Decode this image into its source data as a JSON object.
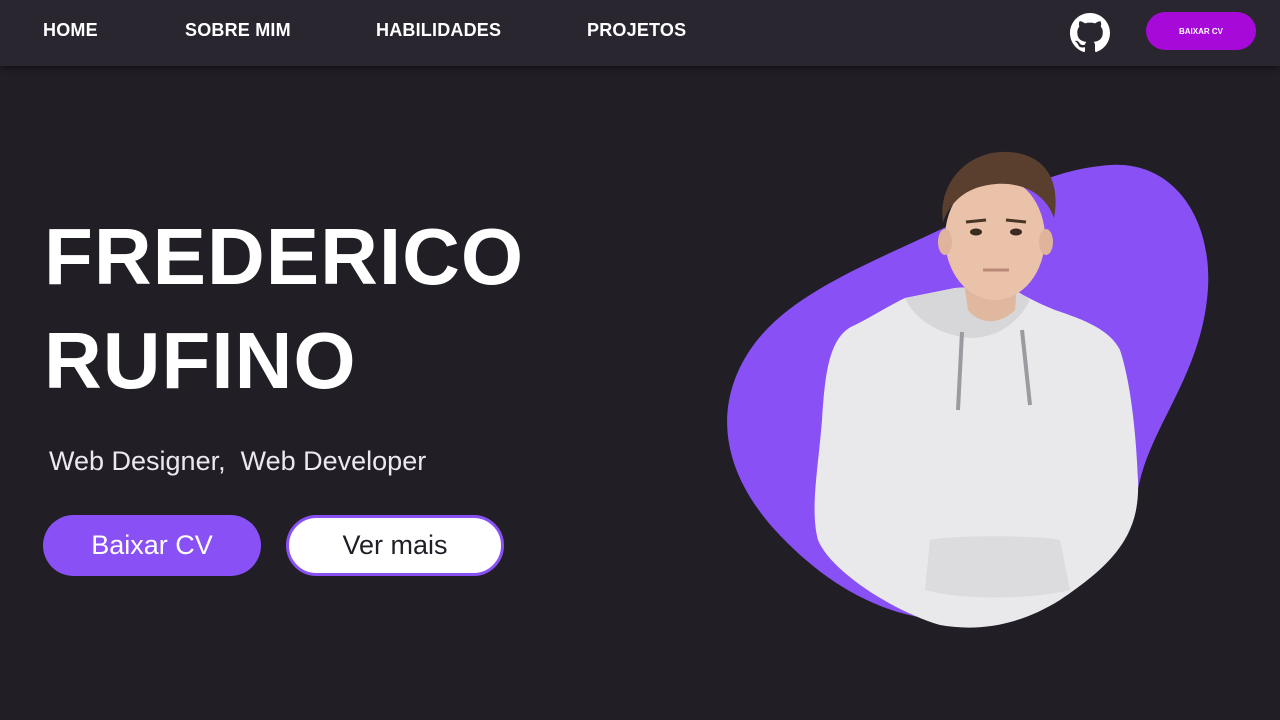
{
  "nav": {
    "links": [
      "HOME",
      "SOBRE MIM",
      "HABILIDADES",
      "PROJETOS"
    ],
    "github_icon": "github-icon",
    "cv_button": "BAIXAR CV"
  },
  "hero": {
    "name_line1": "FREDERICO",
    "name_line2": "RUFINO",
    "subtitle": "Web Designer,  Web Developer",
    "primary_button": "Baixar CV",
    "secondary_button": "Ver mais"
  },
  "colors": {
    "background": "#211e26",
    "navbar": "#29262f",
    "accent": "#8951f5",
    "nav_button": "#a709d8"
  }
}
